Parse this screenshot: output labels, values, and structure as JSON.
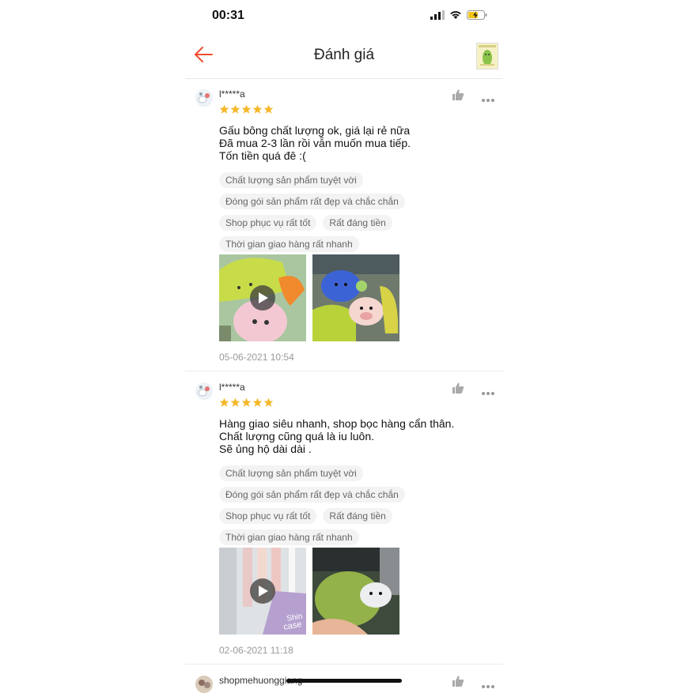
{
  "status_bar": {
    "time": "00:31",
    "icons": [
      "signal-icon",
      "wifi-icon",
      "battery-charging-icon"
    ]
  },
  "header": {
    "title": "Đánh giá",
    "back_icon": "back-arrow-icon",
    "accent_color": "#ee4d2d"
  },
  "reviews": [
    {
      "username": "l*****a",
      "rating": 5,
      "text_lines": [
        "Gấu bông chất lượng ok, giá lại rẻ nữa",
        "Đã mua 2-3 lần rồi vẫn muốn mua tiếp.",
        "Tốn tiền quá đê :("
      ],
      "tags": [
        "Chất lượng sản phẩm tuyệt vời",
        "Đóng gói sản phẩm rất đẹp và chắc chắn",
        "Shop phục vụ rất tốt",
        "Rất đáng tiền",
        "Thời gian giao hàng rất nhanh"
      ],
      "date": "05-06-2021 10:54"
    },
    {
      "username": "l*****a",
      "rating": 5,
      "text_lines": [
        "Hàng giao siêu nhanh, shop bọc hàng cẩn thân.",
        "Chất lượng cũng quá là iu luôn.",
        "Sẽ ủng hộ dài dài ."
      ],
      "tags": [
        "Chất lượng sản phẩm tuyệt vời",
        "Đóng gói sản phẩm rất đẹp và chắc chắn",
        "Shop phục vụ rất tốt",
        "Rất đáng tiền",
        "Thời gian giao hàng rất nhanh"
      ],
      "date": "02-06-2021 11:18",
      "media_text": [
        "Shin",
        "case"
      ]
    },
    {
      "username": "shopmehuonggiang"
    }
  ],
  "star_color": "#f6b82b"
}
